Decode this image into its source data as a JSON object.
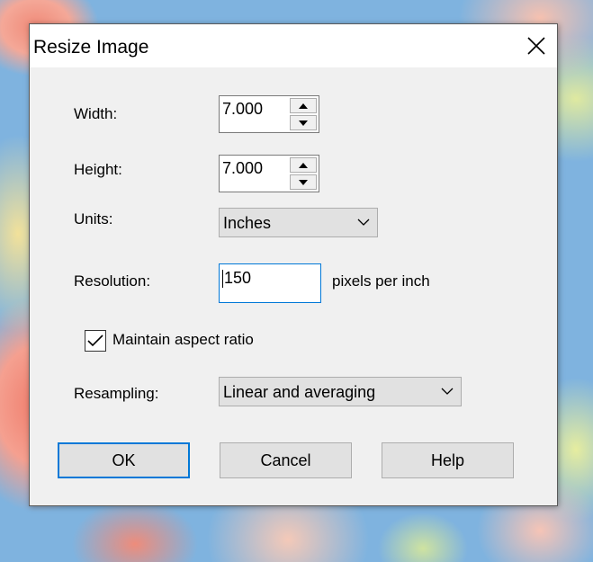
{
  "dialog": {
    "title": "Resize Image",
    "width": {
      "label": "Width:",
      "value": "7.000"
    },
    "height": {
      "label": "Height:",
      "value": "7.000"
    },
    "units": {
      "label": "Units:",
      "value": "Inches"
    },
    "resolution": {
      "label": "Resolution:",
      "value": "150",
      "unit_label": "pixels per inch"
    },
    "maintain_aspect": {
      "label": "Maintain aspect ratio",
      "checked": true
    },
    "resampling": {
      "label": "Resampling:",
      "value": "Linear and averaging"
    },
    "buttons": {
      "ok": "OK",
      "cancel": "Cancel",
      "help": "Help"
    }
  },
  "colors": {
    "focus_border": "#0078d7",
    "dialog_bg": "#f0f0f0",
    "button_bg": "#e1e1e1"
  },
  "icons": [
    "close-icon",
    "spin-up-icon",
    "spin-down-icon",
    "chevron-down-icon",
    "checkmark-icon"
  ]
}
